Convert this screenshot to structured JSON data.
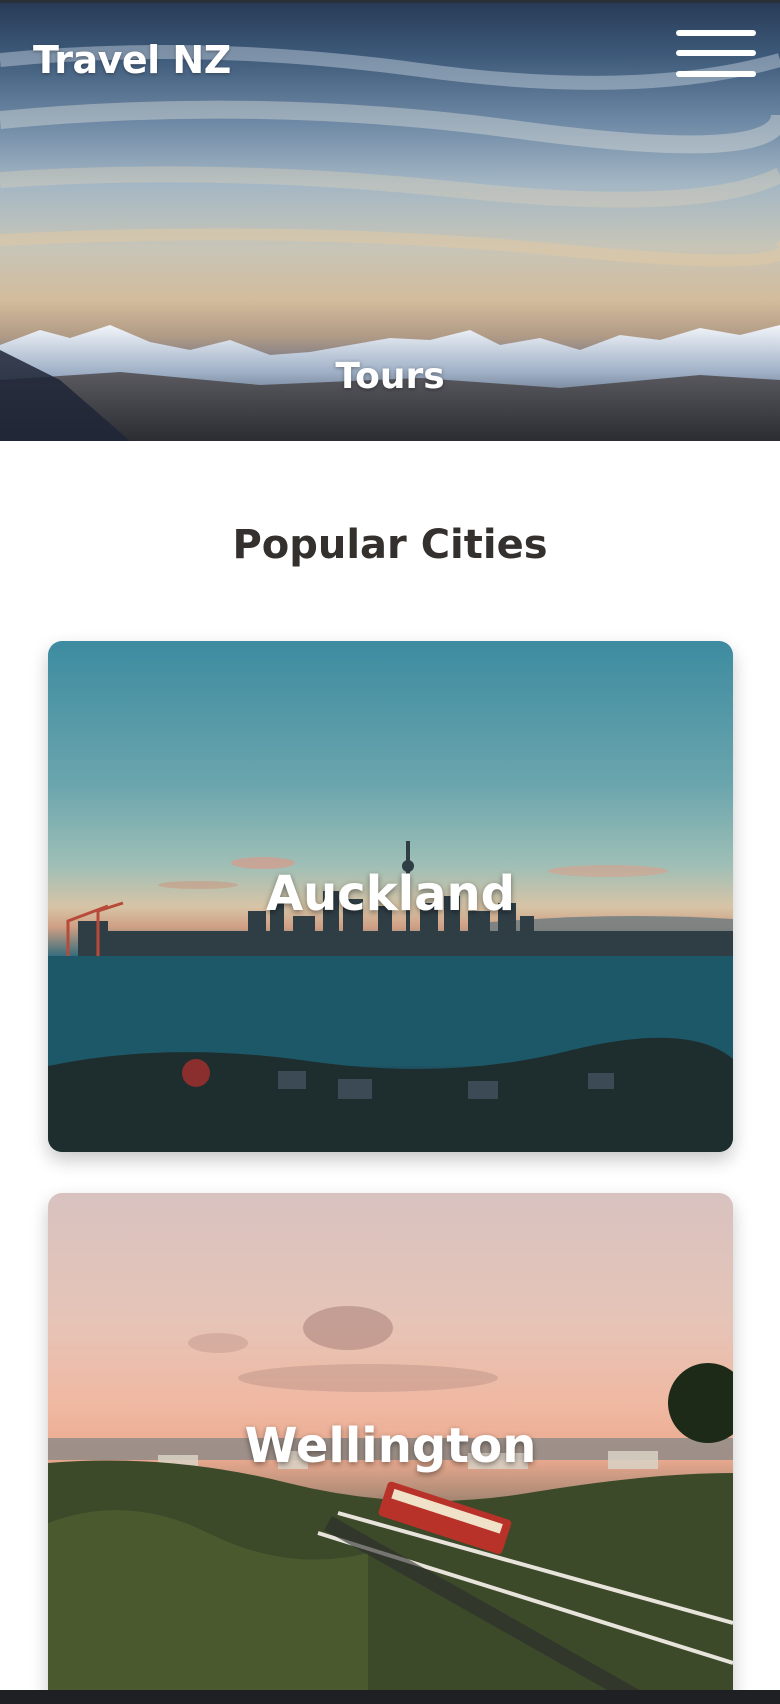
{
  "header": {
    "brand": "Travel NZ",
    "menu_icon": "hamburger-menu-icon"
  },
  "hero": {
    "caption": "Tours"
  },
  "section": {
    "title": "Popular Cities"
  },
  "cities": [
    {
      "name": "Auckland"
    },
    {
      "name": "Wellington"
    }
  ],
  "colors": {
    "heading_text": "#33302d",
    "overlay_text": "#ffffff"
  }
}
